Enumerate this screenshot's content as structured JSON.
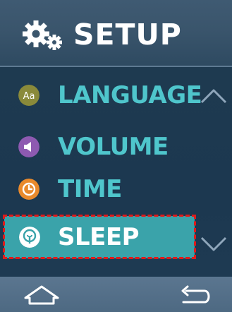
{
  "header": {
    "title": "SETUP",
    "icon": "gear-icon"
  },
  "menu": {
    "items": [
      {
        "label": "LANGUAGE",
        "icon": "language-icon",
        "icon_text": "Aa",
        "color": "#8a8a3a"
      },
      {
        "label": "VOLUME",
        "icon": "speaker-icon",
        "color": "#8e5ab1"
      },
      {
        "label": "TIME",
        "icon": "clock-icon",
        "color": "#e98a2c"
      },
      {
        "label": "SLEEP",
        "icon": "sleep-icon",
        "color": "#3aa3aa",
        "selected": true
      }
    ],
    "scroll_up": "chevron-up-icon",
    "scroll_down": "chevron-down-icon"
  },
  "footer": {
    "home": "home-icon",
    "back": "back-icon"
  },
  "colors": {
    "accent": "#4fc6cc",
    "selected_bg": "#3aa3aa",
    "focus_outline": "#e01a1a",
    "background": "#1f3a50"
  }
}
